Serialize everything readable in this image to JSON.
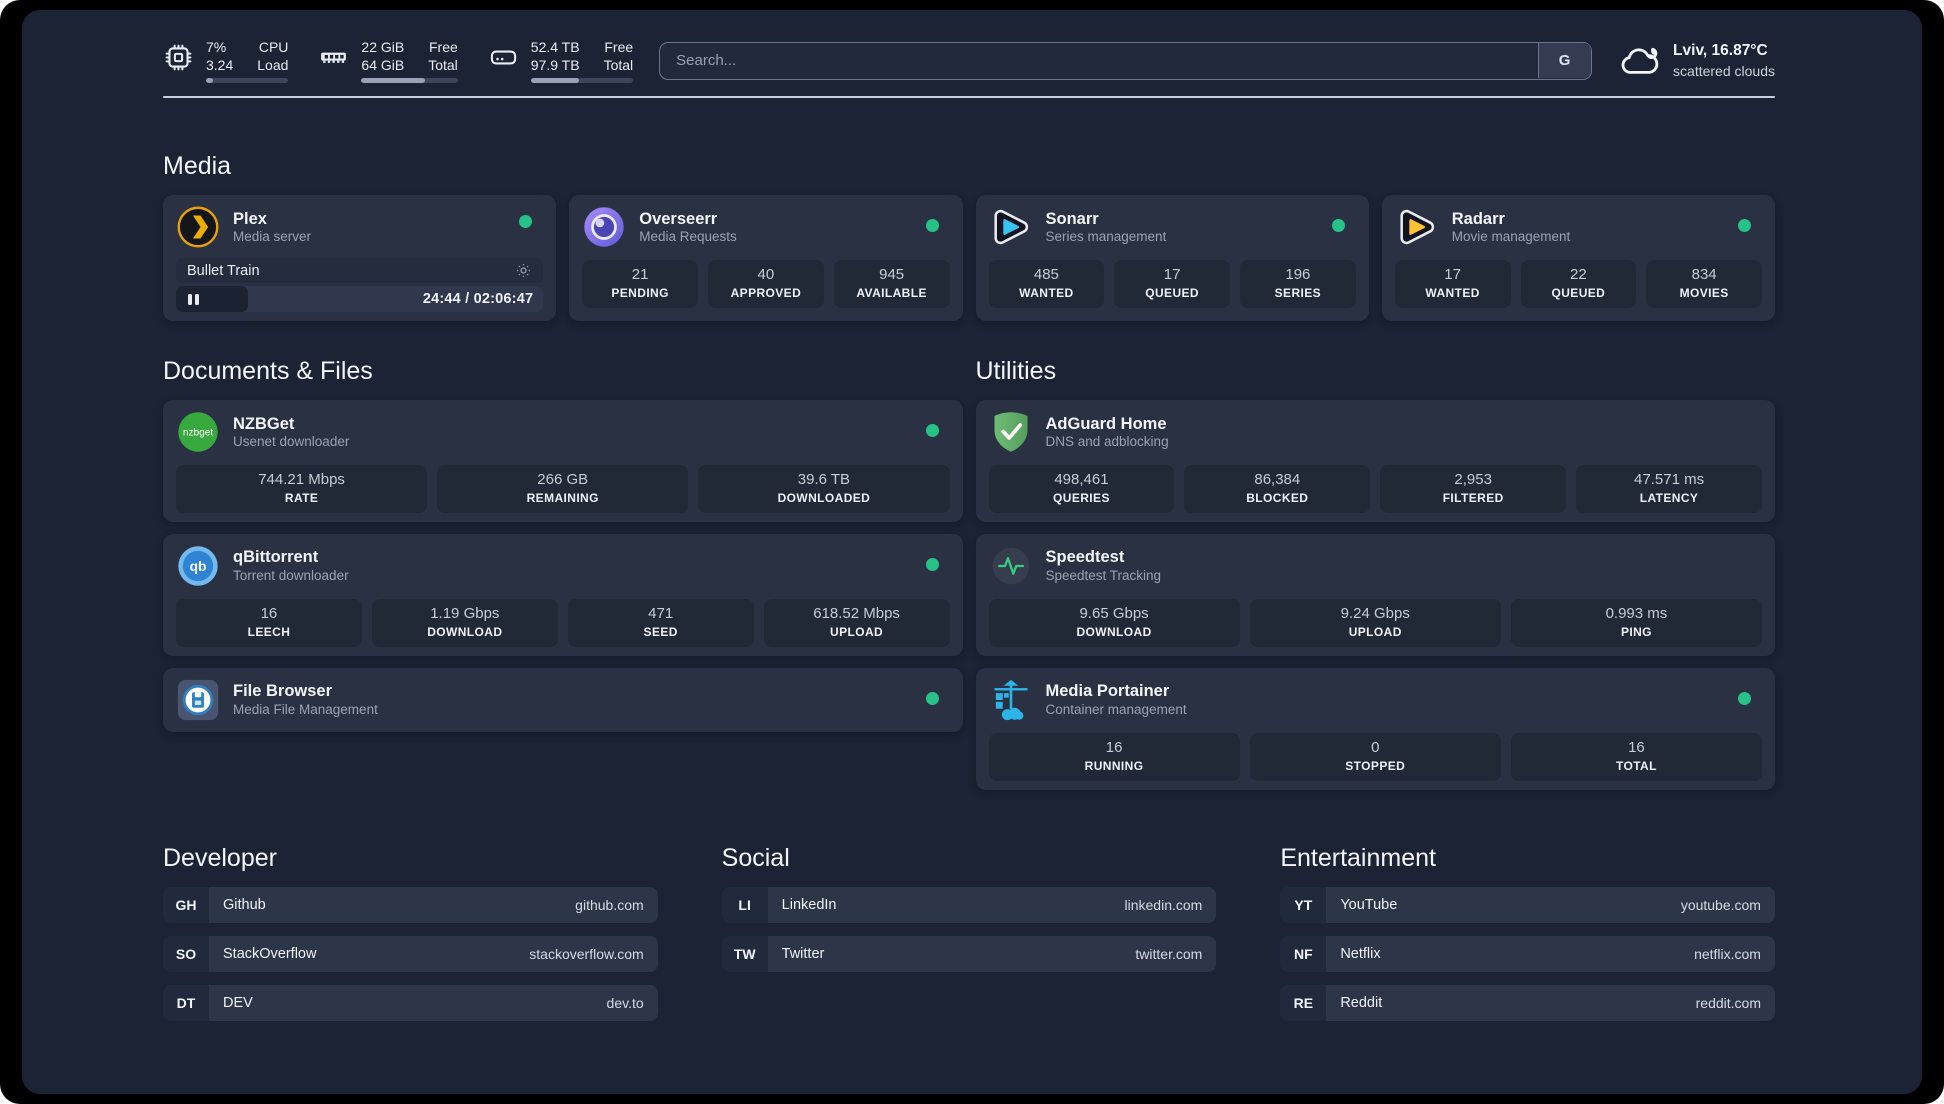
{
  "colors": {
    "page_bg": "#1b2334",
    "card_bg": "#293142",
    "stat_box_bg": "#212937",
    "status_online_green": "#27c287",
    "divider": "#c9d0dc",
    "progress_fill": "#99a1b4"
  },
  "topbar": {
    "stats": [
      {
        "icon": "cpu-icon",
        "values": [
          "7%",
          "3.24"
        ],
        "labels": [
          "CPU",
          "Load"
        ],
        "progress_pct": 8
      },
      {
        "icon": "memory-icon",
        "values": [
          "22 GiB",
          "64 GiB"
        ],
        "labels": [
          "Free",
          "Total"
        ],
        "progress_pct": 66
      },
      {
        "icon": "disk-icon",
        "values": [
          "52.4 TB",
          "97.9 TB"
        ],
        "labels": [
          "Free",
          "Total"
        ],
        "progress_pct": 47
      }
    ],
    "search": {
      "placeholder": "Search...",
      "provider_button": "G"
    },
    "weather": {
      "icon": "cloud-icon",
      "location": "Lviv, 16.87°C",
      "condition": "scattered clouds"
    }
  },
  "media": {
    "title": "Media",
    "plex": {
      "name": "Plex",
      "subtitle": "Media server",
      "icon": "plex-logo",
      "online": true,
      "player": {
        "title": "Bullet Train",
        "time": "24:44 / 02:06:47",
        "progress_pct": 19.5,
        "state": "paused"
      }
    },
    "overseerr": {
      "name": "Overseerr",
      "subtitle": "Media Requests",
      "icon": "overseerr-logo",
      "online": true,
      "stats": [
        {
          "value": "21",
          "label": "PENDING"
        },
        {
          "value": "40",
          "label": "APPROVED"
        },
        {
          "value": "945",
          "label": "AVAILABLE"
        }
      ]
    },
    "sonarr": {
      "name": "Sonarr",
      "subtitle": "Series management",
      "icon": "sonarr-logo",
      "online": true,
      "stats": [
        {
          "value": "485",
          "label": "WANTED"
        },
        {
          "value": "17",
          "label": "QUEUED"
        },
        {
          "value": "196",
          "label": "SERIES"
        }
      ]
    },
    "radarr": {
      "name": "Radarr",
      "subtitle": "Movie management",
      "icon": "radarr-logo",
      "online": true,
      "stats": [
        {
          "value": "17",
          "label": "WANTED"
        },
        {
          "value": "22",
          "label": "QUEUED"
        },
        {
          "value": "834",
          "label": "MOVIES"
        }
      ]
    }
  },
  "documents": {
    "title": "Documents & Files",
    "nzbget": {
      "name": "NZBGet",
      "subtitle": "Usenet downloader",
      "icon": "nzbget-logo",
      "online": true,
      "stats": [
        {
          "value": "744.21 Mbps",
          "label": "RATE"
        },
        {
          "value": "266 GB",
          "label": "REMAINING"
        },
        {
          "value": "39.6 TB",
          "label": "DOWNLOADED"
        }
      ]
    },
    "qbittorrent": {
      "name": "qBittorrent",
      "subtitle": "Torrent downloader",
      "icon": "qbittorrent-logo",
      "online": true,
      "stats": [
        {
          "value": "16",
          "label": "LEECH"
        },
        {
          "value": "1.19 Gbps",
          "label": "DOWNLOAD"
        },
        {
          "value": "471",
          "label": "SEED"
        },
        {
          "value": "618.52 Mbps",
          "label": "UPLOAD"
        }
      ]
    },
    "filebrowser": {
      "name": "File Browser",
      "subtitle": "Media File Management",
      "icon": "filebrowser-logo",
      "online": true
    }
  },
  "utilities": {
    "title": "Utilities",
    "adguard": {
      "name": "AdGuard Home",
      "subtitle": "DNS and adblocking",
      "icon": "adguard-logo",
      "online": false,
      "stats": [
        {
          "value": "498,461",
          "label": "QUERIES"
        },
        {
          "value": "86,384",
          "label": "BLOCKED"
        },
        {
          "value": "2,953",
          "label": "FILTERED"
        },
        {
          "value": "47.571 ms",
          "label": "LATENCY"
        }
      ]
    },
    "speedtest": {
      "name": "Speedtest",
      "subtitle": "Speedtest Tracking",
      "icon": "speedtest-logo",
      "online": false,
      "stats": [
        {
          "value": "9.65 Gbps",
          "label": "DOWNLOAD"
        },
        {
          "value": "9.24 Gbps",
          "label": "UPLOAD"
        },
        {
          "value": "0.993 ms",
          "label": "PING"
        }
      ]
    },
    "portainer": {
      "name": "Media Portainer",
      "subtitle": "Container management",
      "icon": "portainer-logo",
      "online": true,
      "stats": [
        {
          "value": "16",
          "label": "RUNNING"
        },
        {
          "value": "0",
          "label": "STOPPED"
        },
        {
          "value": "16",
          "label": "TOTAL"
        }
      ]
    }
  },
  "link_sections": {
    "developer": {
      "title": "Developer",
      "links": [
        {
          "abbr": "GH",
          "name": "Github",
          "url": "github.com"
        },
        {
          "abbr": "SO",
          "name": "StackOverflow",
          "url": "stackoverflow.com"
        },
        {
          "abbr": "DT",
          "name": "DEV",
          "url": "dev.to"
        }
      ]
    },
    "social": {
      "title": "Social",
      "links": [
        {
          "abbr": "LI",
          "name": "LinkedIn",
          "url": "linkedin.com"
        },
        {
          "abbr": "TW",
          "name": "Twitter",
          "url": "twitter.com"
        }
      ]
    },
    "entertainment": {
      "title": "Entertainment",
      "links": [
        {
          "abbr": "YT",
          "name": "YouTube",
          "url": "youtube.com"
        },
        {
          "abbr": "NF",
          "name": "Netflix",
          "url": "netflix.com"
        },
        {
          "abbr": "RE",
          "name": "Reddit",
          "url": "reddit.com"
        }
      ]
    }
  },
  "logo_texts": {
    "nzbget": "nzbget",
    "qbittorrent": "qb"
  }
}
